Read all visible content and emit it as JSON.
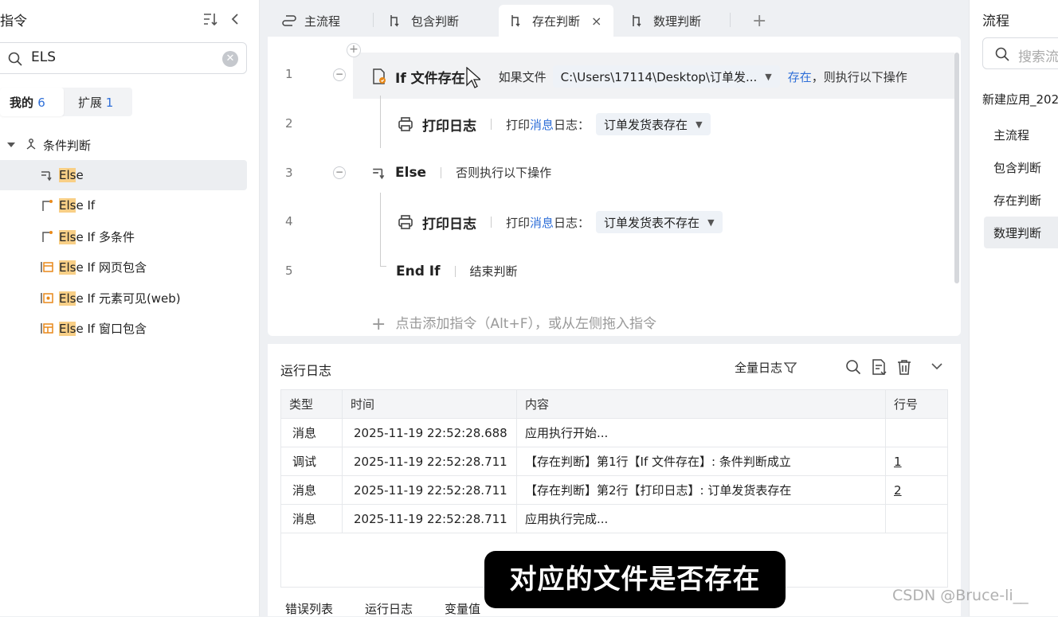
{
  "left_panel": {
    "title": "指令",
    "search": {
      "value": "ELS"
    },
    "tabs": [
      {
        "label": "我的",
        "count": "6"
      },
      {
        "label": "扩展",
        "count": "1"
      }
    ],
    "group": {
      "label": "条件判断"
    },
    "items": [
      {
        "hl": "Els",
        "rest": "e",
        "icon": "else-icon"
      },
      {
        "hl": "Els",
        "rest": "e If",
        "icon": "else-if-icon"
      },
      {
        "hl": "Els",
        "rest": "e If 多条件",
        "icon": "else-if-multi-icon"
      },
      {
        "hl": "Els",
        "rest": "e If 网页包含",
        "icon": "web-contains-icon"
      },
      {
        "hl": "Els",
        "rest": "e If 元素可见(web)",
        "icon": "element-visible-icon"
      },
      {
        "hl": "Els",
        "rest": "e If 窗口包含",
        "icon": "window-contains-icon"
      }
    ]
  },
  "tabs": [
    {
      "label": "主流程"
    },
    {
      "label": "包含判断"
    },
    {
      "label": "存在判断",
      "close": "×"
    },
    {
      "label": "数理判断"
    }
  ],
  "new_tab": "+",
  "editor": {
    "line_numbers": [
      "1",
      "2",
      "3",
      "4",
      "5"
    ],
    "collapse_sign": "−",
    "add_sign": "+",
    "row1": {
      "title": "If 文件存在",
      "prefix": "如果文件",
      "path": "C:\\Users\\17114\\Desktop\\订单发...",
      "cond": "存在",
      "suffix": "，则执行以下操作"
    },
    "row2": {
      "title": "打印日志",
      "pre": "打印",
      "mid": "消息",
      "post": "日志：",
      "value": "订单发货表存在"
    },
    "row3": {
      "title": "Else",
      "desc": "否则执行以下操作"
    },
    "row4": {
      "title": "打印日志",
      "pre": "打印",
      "mid": "消息",
      "post": "日志：",
      "value": "订单发货表不存在"
    },
    "row5": {
      "title": "End If",
      "desc": "结束判断"
    },
    "add_hint": "点击添加指令（Alt+F），或从左侧拖入指令"
  },
  "log": {
    "title": "运行日志",
    "filter": "全量日志",
    "columns": [
      "类型",
      "时间",
      "内容",
      "行号"
    ],
    "rows": [
      {
        "type": "消息",
        "time": "2025-11-19 22:52:28.688",
        "content": "应用执行开始...",
        "line": ""
      },
      {
        "type": "调试",
        "time": "2025-11-19 22:52:28.711",
        "content": "【存在判断】第1行【If 文件存在】: 条件判断成立",
        "line": "1"
      },
      {
        "type": "消息",
        "time": "2025-11-19 22:52:28.711",
        "content": "【存在判断】第2行【打印日志】: 订单发货表存在",
        "line": "2"
      },
      {
        "type": "消息",
        "time": "2025-11-19 22:52:28.711",
        "content": "应用执行完成...",
        "line": ""
      }
    ],
    "bottom_tabs": [
      "错误列表",
      "运行日志",
      "变量值"
    ]
  },
  "right_panel": {
    "title": "流程",
    "search_placeholder": "搜索流",
    "app_name": "新建应用_202",
    "items": [
      "主流程",
      "包含判断",
      "存在判断",
      "数理判断"
    ]
  },
  "subtitle": "对应的文件是否存在",
  "watermark": "CSDN @Bruce-li__",
  "colors": {
    "accent": "#2f6fd8",
    "highlight": "#f8cf86",
    "icon_orange": "#e8891a"
  }
}
